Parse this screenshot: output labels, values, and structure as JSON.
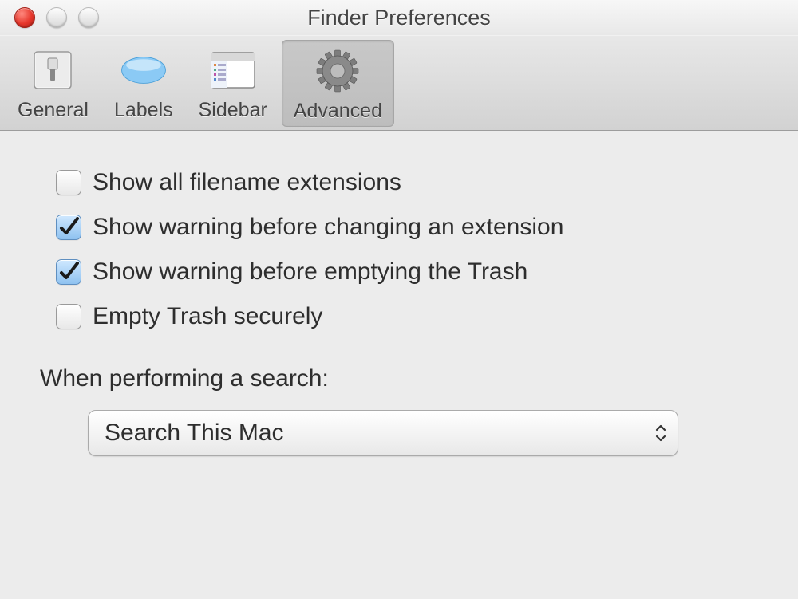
{
  "window": {
    "title": "Finder Preferences"
  },
  "toolbar": {
    "items": [
      {
        "label": "General"
      },
      {
        "label": "Labels"
      },
      {
        "label": "Sidebar"
      },
      {
        "label": "Advanced"
      }
    ],
    "selected": 3
  },
  "options": {
    "show_extensions": {
      "label": "Show all filename extensions",
      "checked": false
    },
    "warn_extension": {
      "label": "Show warning before changing an extension",
      "checked": true
    },
    "warn_trash": {
      "label": "Show warning before emptying the Trash",
      "checked": true
    },
    "secure_trash": {
      "label": "Empty Trash securely",
      "checked": false
    }
  },
  "search": {
    "label": "When performing a search:",
    "value": "Search This Mac"
  }
}
